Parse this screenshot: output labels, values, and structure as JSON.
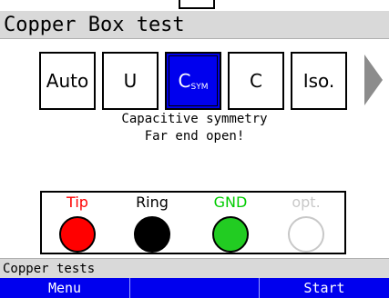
{
  "title": "Copper Box test",
  "modes": [
    {
      "label": "Auto",
      "sub": ""
    },
    {
      "label": "U",
      "sub": ""
    },
    {
      "label": "C",
      "sub": "SYM"
    },
    {
      "label": "C",
      "sub": ""
    },
    {
      "label": "Iso.",
      "sub": ""
    }
  ],
  "selected_mode_index": 2,
  "message": {
    "line1": "Capacitive symmetry",
    "line2": "Far end open!"
  },
  "terminals": [
    {
      "label": "Tip",
      "label_color": "#ff0000",
      "dot_color": "#ff0000",
      "border_color": "#000000"
    },
    {
      "label": "Ring",
      "label_color": "#000000",
      "dot_color": "#000000",
      "border_color": "#000000"
    },
    {
      "label": "GND",
      "label_color": "#00cc00",
      "dot_color": "#22cc22",
      "border_color": "#000000"
    },
    {
      "label": "opt.",
      "label_color": "#c8c8c8",
      "dot_color": "#ffffff",
      "border_color": "#c8c8c8"
    }
  ],
  "status": "Copper tests",
  "softkeys": {
    "left": "Menu",
    "middle": "",
    "right": "Start"
  },
  "colors": {
    "accent_blue": "#0000ee",
    "header_gray": "#d9d9d9",
    "arrow_gray": "#8c8c8c"
  },
  "icons": {
    "next": "triangle-right-icon"
  }
}
